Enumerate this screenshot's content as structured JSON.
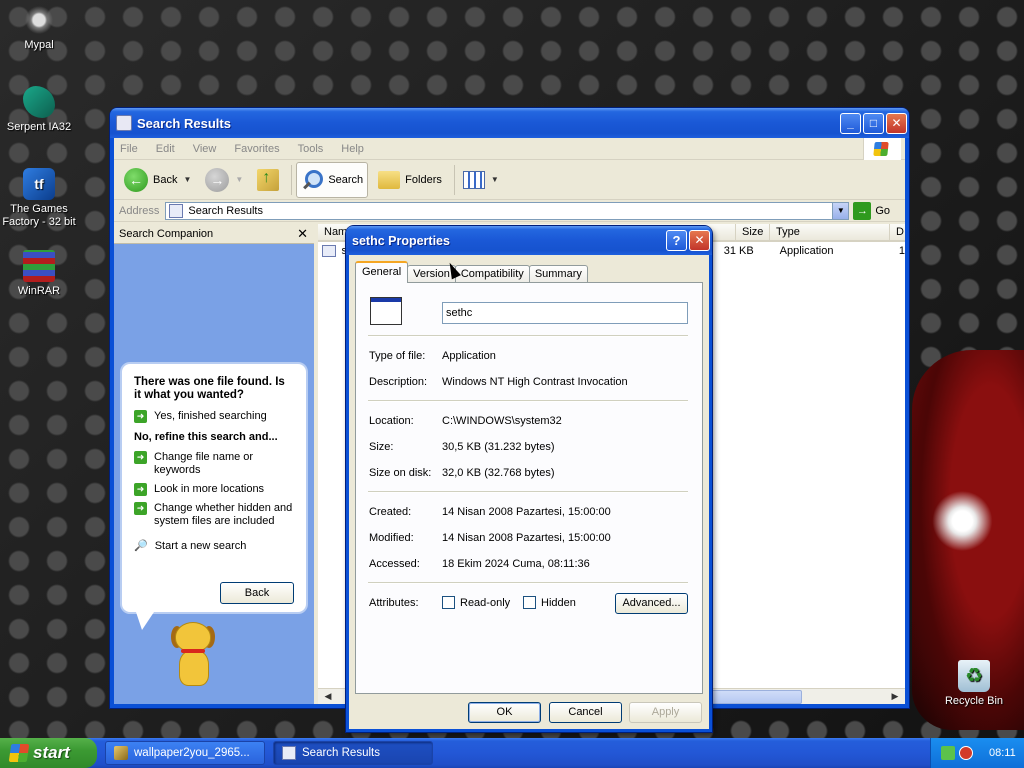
{
  "desktop": {
    "icons": [
      {
        "label": "Mypal",
        "icon": "mypal-icon"
      },
      {
        "label": "Serpent IA32",
        "icon": "serpent-icon"
      },
      {
        "label": "The Games Factory - 32 bit",
        "icon": "games-factory-icon"
      },
      {
        "label": "WinRAR",
        "icon": "winrar-icon"
      },
      {
        "label": "Recycle Bin",
        "icon": "recycle-bin-icon"
      }
    ]
  },
  "explorer": {
    "title": "Search Results",
    "menu": [
      "File",
      "Edit",
      "View",
      "Favorites",
      "Tools",
      "Help"
    ],
    "toolbar": {
      "back": "Back",
      "search": "Search",
      "folders": "Folders"
    },
    "address": {
      "label": "Address",
      "value": "Search Results",
      "go": "Go"
    },
    "companion": {
      "title": "Search Companion",
      "close": "✕",
      "found_text": "There was one file found.  Is it what you wanted?",
      "yes": "Yes, finished searching",
      "refine": "No, refine this search and...",
      "change_name": "Change file name or keywords",
      "more_locations": "Look in more locations",
      "hidden": "Change whether hidden and system files are included",
      "new_search": "Start a new search",
      "back_button": "Back"
    },
    "list": {
      "columns": [
        "Nam",
        "Size",
        "Type",
        "D"
      ],
      "rows": [
        {
          "name": "se",
          "size": "31 KB",
          "type": "Application",
          "d": "1"
        }
      ]
    }
  },
  "dialog": {
    "title": "sethc Properties",
    "tabs": [
      "General",
      "Version",
      "Compatibility",
      "Summary"
    ],
    "name": "sethc",
    "fields": {
      "type_label": "Type of file:",
      "type_value": "Application",
      "desc_label": "Description:",
      "desc_value": "Windows NT High Contrast Invocation",
      "loc_label": "Location:",
      "loc_value": "C:\\WINDOWS\\system32",
      "size_label": "Size:",
      "size_value": "30,5 KB (31.232 bytes)",
      "disk_label": "Size on disk:",
      "disk_value": "32,0 KB (32.768 bytes)",
      "created_label": "Created:",
      "created_value": "14 Nisan 2008 Pazartesi, 15:00:00",
      "modified_label": "Modified:",
      "modified_value": "14 Nisan 2008 Pazartesi, 15:00:00",
      "accessed_label": "Accessed:",
      "accessed_value": "18 Ekim 2024 Cuma, 08:11:36",
      "attr_label": "Attributes:",
      "readonly": "Read-only",
      "hidden": "Hidden",
      "advanced": "Advanced..."
    },
    "buttons": {
      "ok": "OK",
      "cancel": "Cancel",
      "apply": "Apply"
    }
  },
  "taskbar": {
    "start": "start",
    "tasks": [
      "wallpaper2you_2965...",
      "Search Results"
    ],
    "clock": "08:11"
  }
}
